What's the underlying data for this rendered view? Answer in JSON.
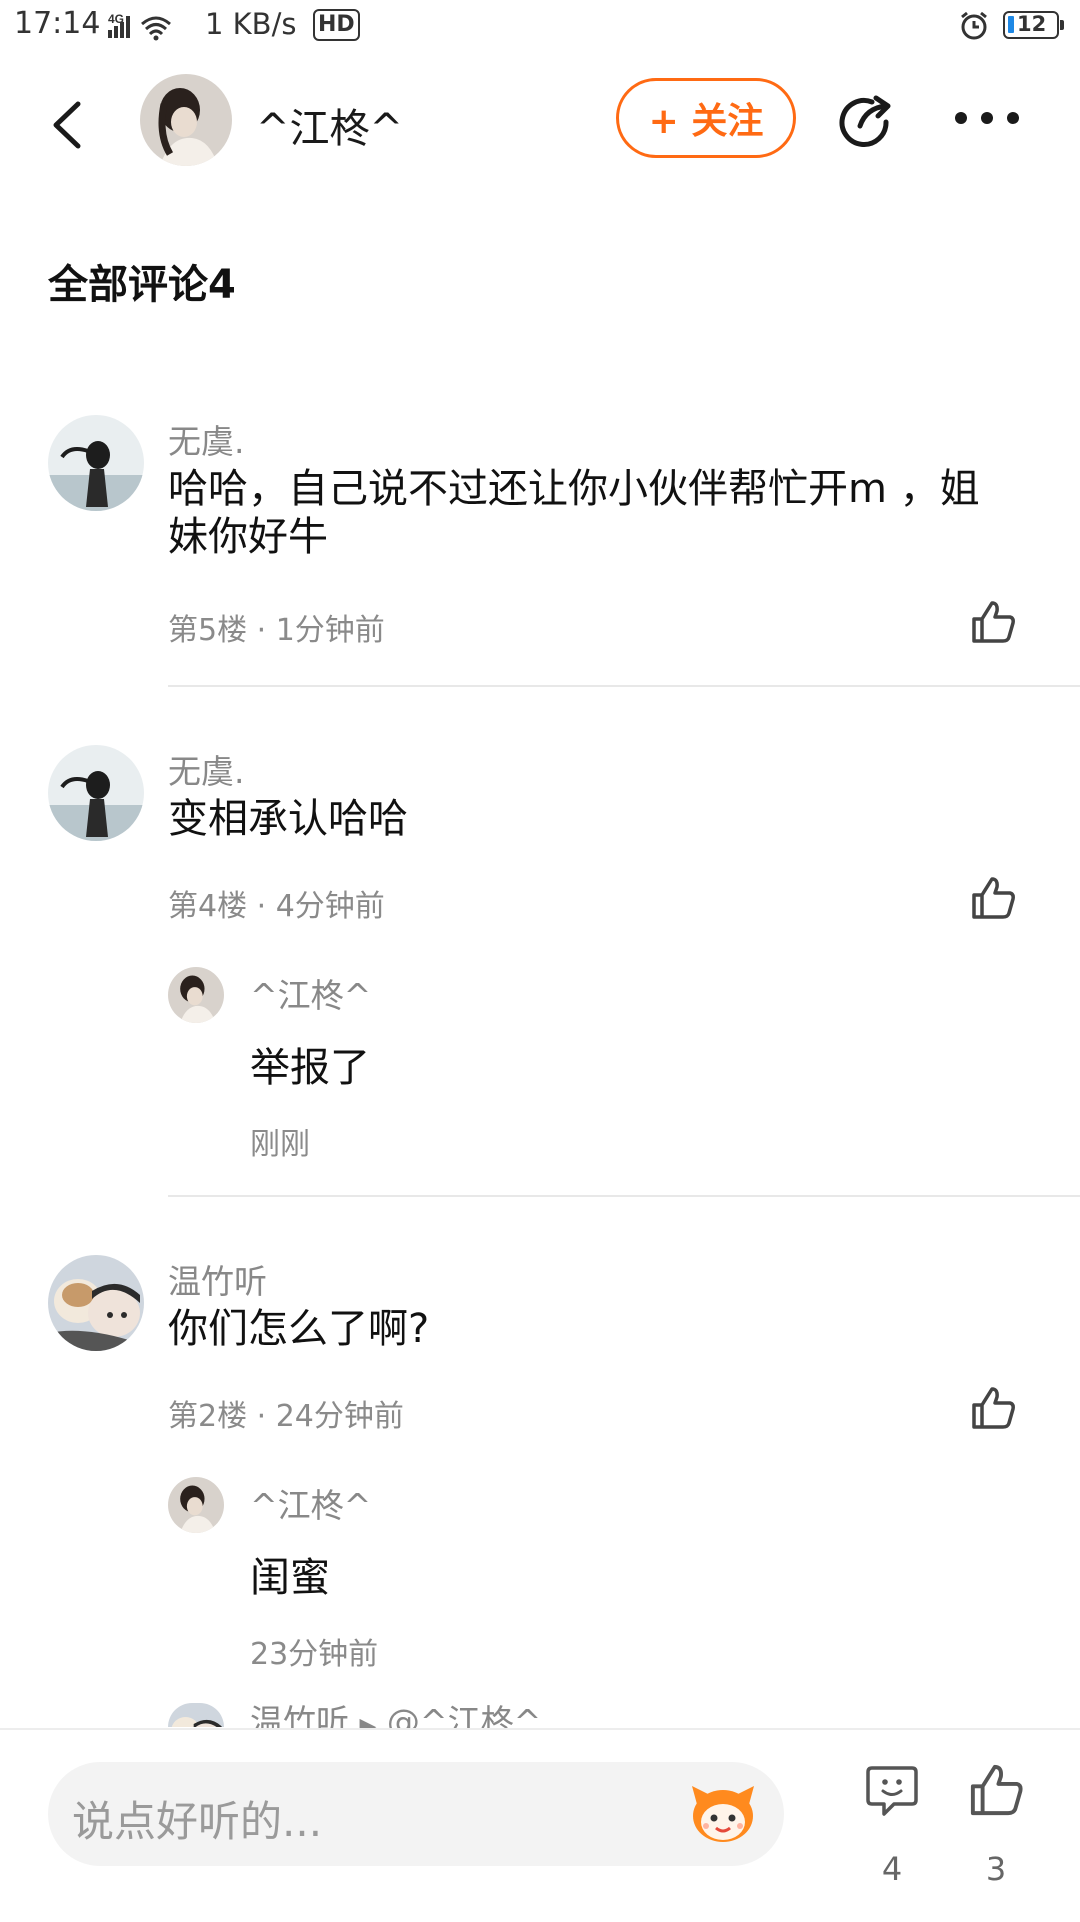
{
  "status_bar": {
    "time": "17:14",
    "network": "4G",
    "speed": "1 KB/s",
    "hd": "HD",
    "battery": "12"
  },
  "header": {
    "username": "^江柊^",
    "follow_label": "+ 关注"
  },
  "comments_section": {
    "title": "全部评论4"
  },
  "comments": [
    {
      "author": "无虞.",
      "text": "哈哈，自己说不过还让你小伙伴帮忙开m ，姐妹你好牛",
      "meta": "第5楼 · 1分钟前"
    },
    {
      "author": "无虞.",
      "text": "变相承认哈哈",
      "meta": "第4楼 · 4分钟前",
      "reply": {
        "author": "^江柊^",
        "text": "举报了",
        "meta": "刚刚"
      }
    },
    {
      "author": "温竹听",
      "text": "你们怎么了啊?",
      "meta": "第2楼 · 24分钟前",
      "reply": {
        "author": "^江柊^",
        "text": "闺蜜",
        "meta": "23分钟前"
      },
      "reply2": {
        "author": "温竹听",
        "target": "@^江柊^"
      }
    }
  ],
  "bottom_bar": {
    "placeholder": "说点好听的...",
    "comment_count": "4",
    "like_count": "3"
  },
  "colors": {
    "accent": "#ff6a13",
    "meta_gray": "#8a8a8a"
  }
}
